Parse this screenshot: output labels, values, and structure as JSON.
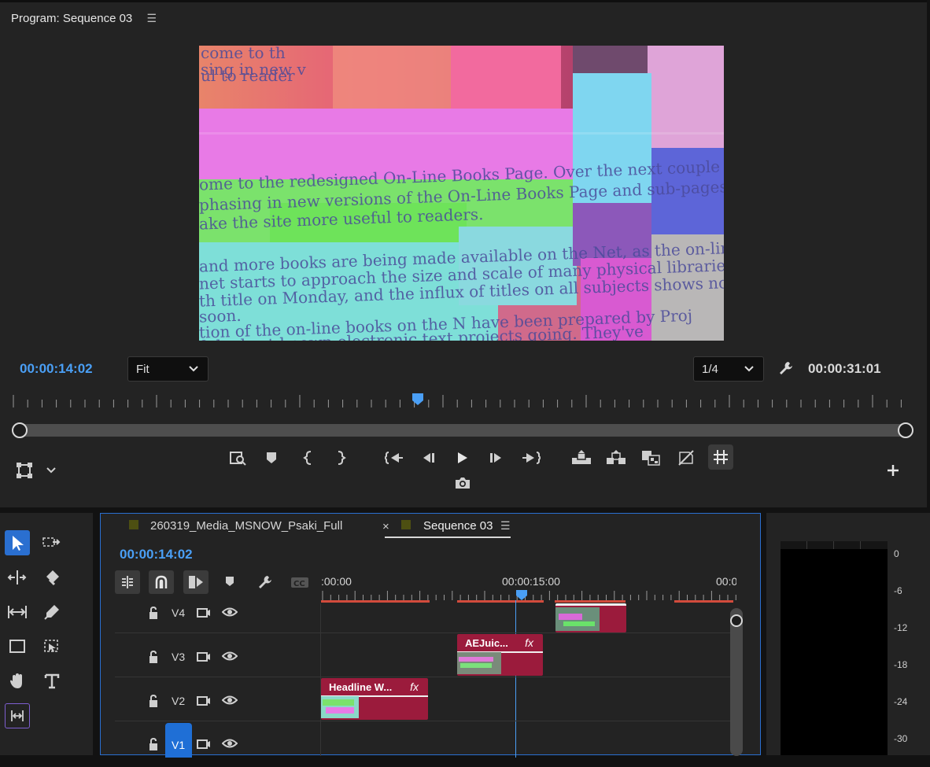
{
  "program_monitor": {
    "title": "Program: Sequence 03",
    "current_time": "00:00:14:02",
    "duration": "00:00:31:01",
    "zoom_select": "Fit",
    "resolution_select": "1/4",
    "playhead_position": 0.45,
    "video_text_lines": [
      "come to th",
      "sing in new v",
      "ul to reader",
      "ome to the redesigned On-Line Books Page. Over the next couple of",
      "phasing in new versions of the On-Line Books Page and sub-pages,",
      "ake the site more useful to readers.",
      "and more books are being made available on the Net, as the on-line lib",
      "net starts to approach the size and scale of many physical libraries. We",
      "th title on Monday, and the influx of titles on all subjects shows no sign",
      "soon.",
      "tion of the on-line books on the N   have been prepared by Proj",
      "f the best-known electronic text projects going. They've"
    ]
  },
  "timeline": {
    "tabs": [
      {
        "label": "260319_Media_MSNOW_Psaki_Full"
      },
      {
        "label": "Sequence 03"
      }
    ],
    "current_time": "00:00:14:02",
    "ruler_labels": [
      ":00:00",
      "00:00:15:00",
      "00:0"
    ],
    "tracks": [
      {
        "label": "V4"
      },
      {
        "label": "V3"
      },
      {
        "label": "V2"
      },
      {
        "label": "V1"
      }
    ],
    "clips": [
      {
        "title": "AEJuic...",
        "fx": "fx"
      },
      {
        "title": "Headline W...",
        "fx": "fx"
      }
    ]
  },
  "audio_meter": {
    "labels": [
      "0",
      "-6",
      "-12",
      "-18",
      "-24",
      "-30"
    ]
  },
  "colors": {
    "accent_blue": "#4a9ff5",
    "clip_red": "#9b1b3c",
    "selection_blue": "#1f6fd6"
  }
}
